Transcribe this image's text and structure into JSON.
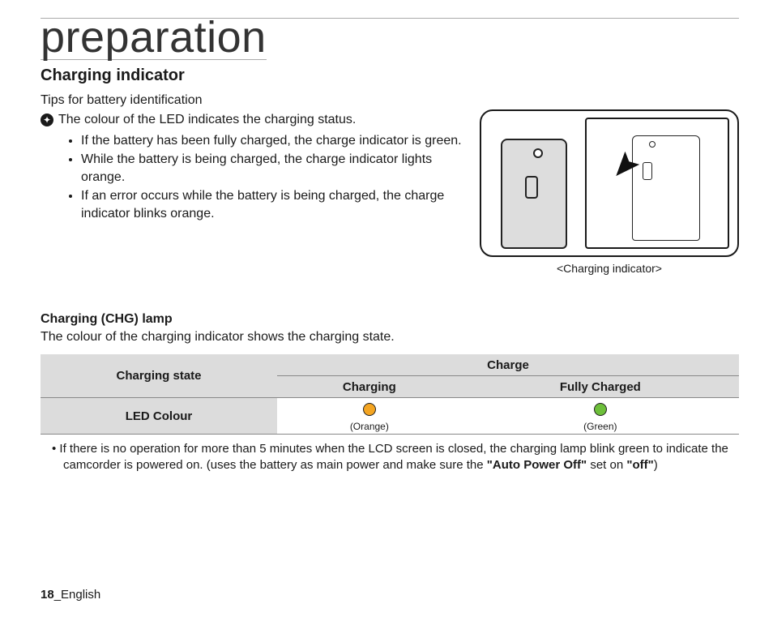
{
  "title": "preparation",
  "section_heading": "Charging indicator",
  "tips_line": "Tips for battery identification",
  "star_bullet": "The colour of the LED indicates the charging status.",
  "bullets": [
    "If the battery has been fully charged, the charge indicator is green.",
    "While the battery is being charged, the charge indicator lights orange.",
    "If an error occurs while the battery is being charged, the charge indicator blinks orange."
  ],
  "figure_caption": "<Charging indicator>",
  "chg_heading": "Charging (CHG) lamp",
  "chg_line": "The colour of the charging indicator shows the charging state.",
  "table": {
    "charging_state": "Charging state",
    "charge": "Charge",
    "charging": "Charging",
    "fully_charged": "Fully Charged",
    "led_colour": "LED Colour",
    "orange_label": "(Orange)",
    "green_label": "(Green)"
  },
  "bottom_note_pre": "If there is no operation for more than 5 minutes when the LCD screen is closed, the charging lamp blink green to indicate the camcorder is powered on. (uses the battery as main power and make sure the ",
  "bottom_note_bold_a": "\"Auto Power Off\"",
  "bottom_note_mid": " set on ",
  "bottom_note_bold_b": "\"off\"",
  "bottom_note_post": ")",
  "page_number": "18",
  "page_lang": "_English"
}
